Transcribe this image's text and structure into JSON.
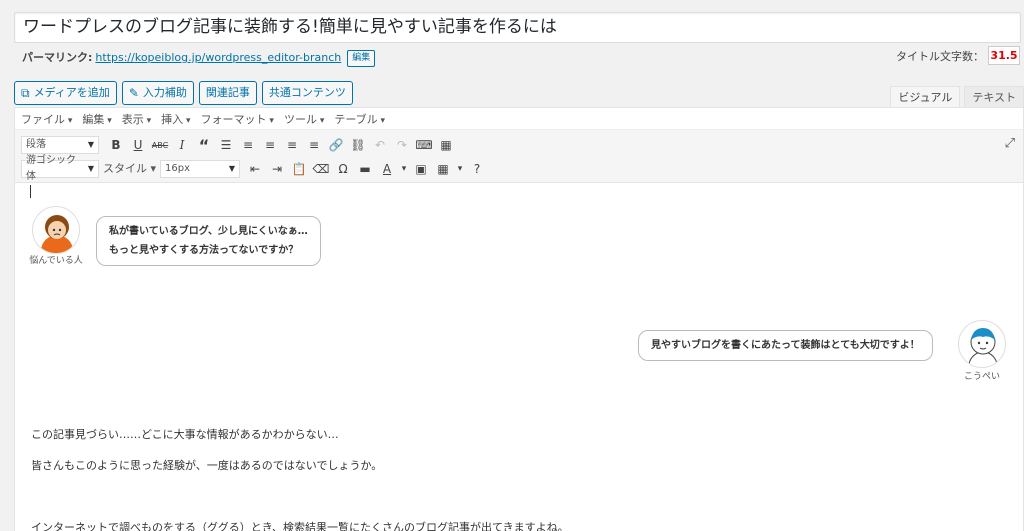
{
  "title": "ワードプレスのブログ記事に装飾する!簡単に見やすい記事を作るには",
  "permalink": {
    "label": "パーマリンク:",
    "url": "https://kopeiblog.jp/wordpress_editor-branch",
    "edit_label": "編集"
  },
  "title_count": {
    "label": "タイトル文字数：",
    "value": "31.5"
  },
  "buttons": {
    "add_media": "メディアを追加",
    "input_assist": "入力補助",
    "related": "関連記事",
    "shared": "共通コンテンツ"
  },
  "mode_tabs": {
    "visual": "ビジュアル",
    "text": "テキスト"
  },
  "menu": [
    "ファイル",
    "編集",
    "表示",
    "挿入",
    "フォーマット",
    "ツール",
    "テーブル"
  ],
  "format_select": "段落",
  "font_select": "游ゴシック体",
  "style_label": "スタイル",
  "size_select": "16px",
  "speech1": {
    "name": "悩んでいる人",
    "lines": [
      "私が書いているブログ、少し見にくいなぁ…",
      "もっと見やすくする方法ってないですか？"
    ]
  },
  "speech2": {
    "name": "こうぺい",
    "text": "見やすいブログを書くにあたって装飾はとても大切ですよ！"
  },
  "paragraphs": [
    "この記事見づらい……どこに大事な情報があるかわからない…",
    "皆さんもこのように思った経験が、一度はあるのではないでしょうか。",
    "インターネットで調べものをする（ググる）とき、検索結果一覧にたくさんのブログ記事が出てきますよね。"
  ]
}
